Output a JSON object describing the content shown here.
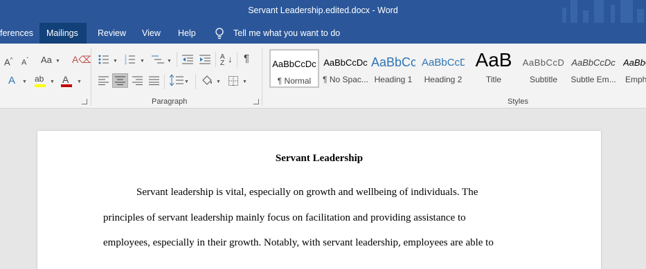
{
  "window": {
    "title": "Servant Leadership.edited.docx  -  Word"
  },
  "tabs": [
    {
      "label": "ferences"
    },
    {
      "label": "Mailings"
    },
    {
      "label": "Review"
    },
    {
      "label": "View"
    },
    {
      "label": "Help"
    }
  ],
  "tell_me": {
    "label": "Tell me what you want to do"
  },
  "ribbon": {
    "paragraph_group_label": "Paragraph",
    "styles_group_label": "Styles",
    "styles": [
      {
        "sample": "AaBbCcDc",
        "name": "¶ Normal",
        "selected": true
      },
      {
        "sample": "AaBbCcDc",
        "name": "¶ No Spac..."
      },
      {
        "sample": "AaBbCc",
        "name": "Heading 1"
      },
      {
        "sample": "AaBbCcD",
        "name": "Heading 2"
      },
      {
        "sample": "AaB",
        "name": "Title"
      },
      {
        "sample": "AaBbCcD",
        "name": "Subtitle"
      },
      {
        "sample": "AaBbCcDc",
        "name": "Subtle Em..."
      },
      {
        "sample": "AaBbCcDc",
        "name": "Emph"
      }
    ]
  },
  "document": {
    "title": "Servant Leadership",
    "lines": [
      "Servant leadership is vital, especially on growth and wellbeing of individuals. The",
      "principles of servant leadership mainly focus on facilitation and providing assistance to",
      "employees, especially in their growth. Notably, with servant leadership, employees are able to"
    ]
  },
  "colors": {
    "titlebar": "#2b579a",
    "active_tab": "#124078",
    "ribbon": "#f3f3f3",
    "workspace": "#e6e6e6",
    "font_color_bar": "#c00000",
    "highlight_bar": "#ffff00"
  }
}
